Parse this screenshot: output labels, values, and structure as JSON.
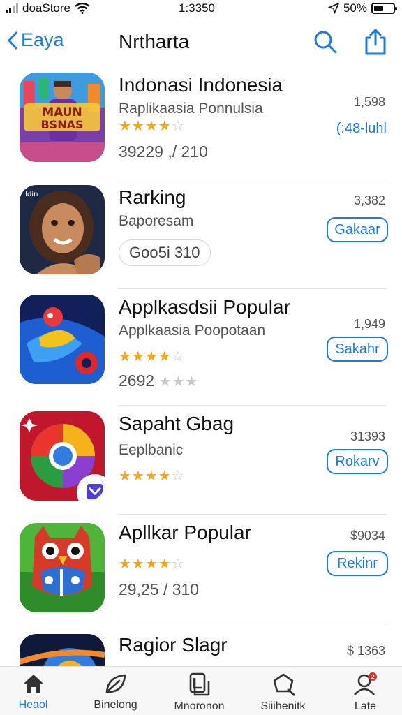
{
  "status_bar": {
    "carrier": "doaStore",
    "time": "1:3350",
    "battery": "50%",
    "battery_level": 0.5
  },
  "nav": {
    "back_label": "Eaya",
    "title": "Nrtharta"
  },
  "apps": [
    {
      "name": "Indonasi Indonesia",
      "subtitle": "Raplikaasia Ponnulsia",
      "rating": 4,
      "line3": "39229 ,/ 210",
      "count": "1,598",
      "action": "(:48-luhl"
    },
    {
      "name": "Rarking",
      "subtitle": "Baporesam",
      "pill": "Goo5i 310",
      "count": "3,382",
      "action": "Gakaar"
    },
    {
      "name": "Applkasdsii Popular",
      "subtitle": "Applkaasia Poopotaan",
      "rating": 4,
      "line3": "2692",
      "line3_stars": 1,
      "count": "1,949",
      "action": "Sakahr"
    },
    {
      "name": "Sapaht Gbag",
      "subtitle": "Eeplbanic",
      "rating": 4,
      "count": "31393",
      "action": "Rokarv"
    },
    {
      "name": "Apllkar Popular",
      "rating": 4,
      "line3": "29,25 / 310",
      "count": "$9034",
      "action": "Rekinr"
    },
    {
      "name": "Ragior Slagr",
      "count": "$ 1363"
    }
  ],
  "tabs": [
    {
      "label": "Heaol",
      "icon": "home-icon"
    },
    {
      "label": "Binelong",
      "icon": "leaf-icon"
    },
    {
      "label": "Mnoronon",
      "icon": "layers-icon"
    },
    {
      "label": "Siiihenitk",
      "icon": "search-icon"
    },
    {
      "label": "Late",
      "icon": "profile-icon",
      "badge": "2"
    }
  ],
  "colors": {
    "accent": "#1c7ce0",
    "star": "#f2a619"
  }
}
